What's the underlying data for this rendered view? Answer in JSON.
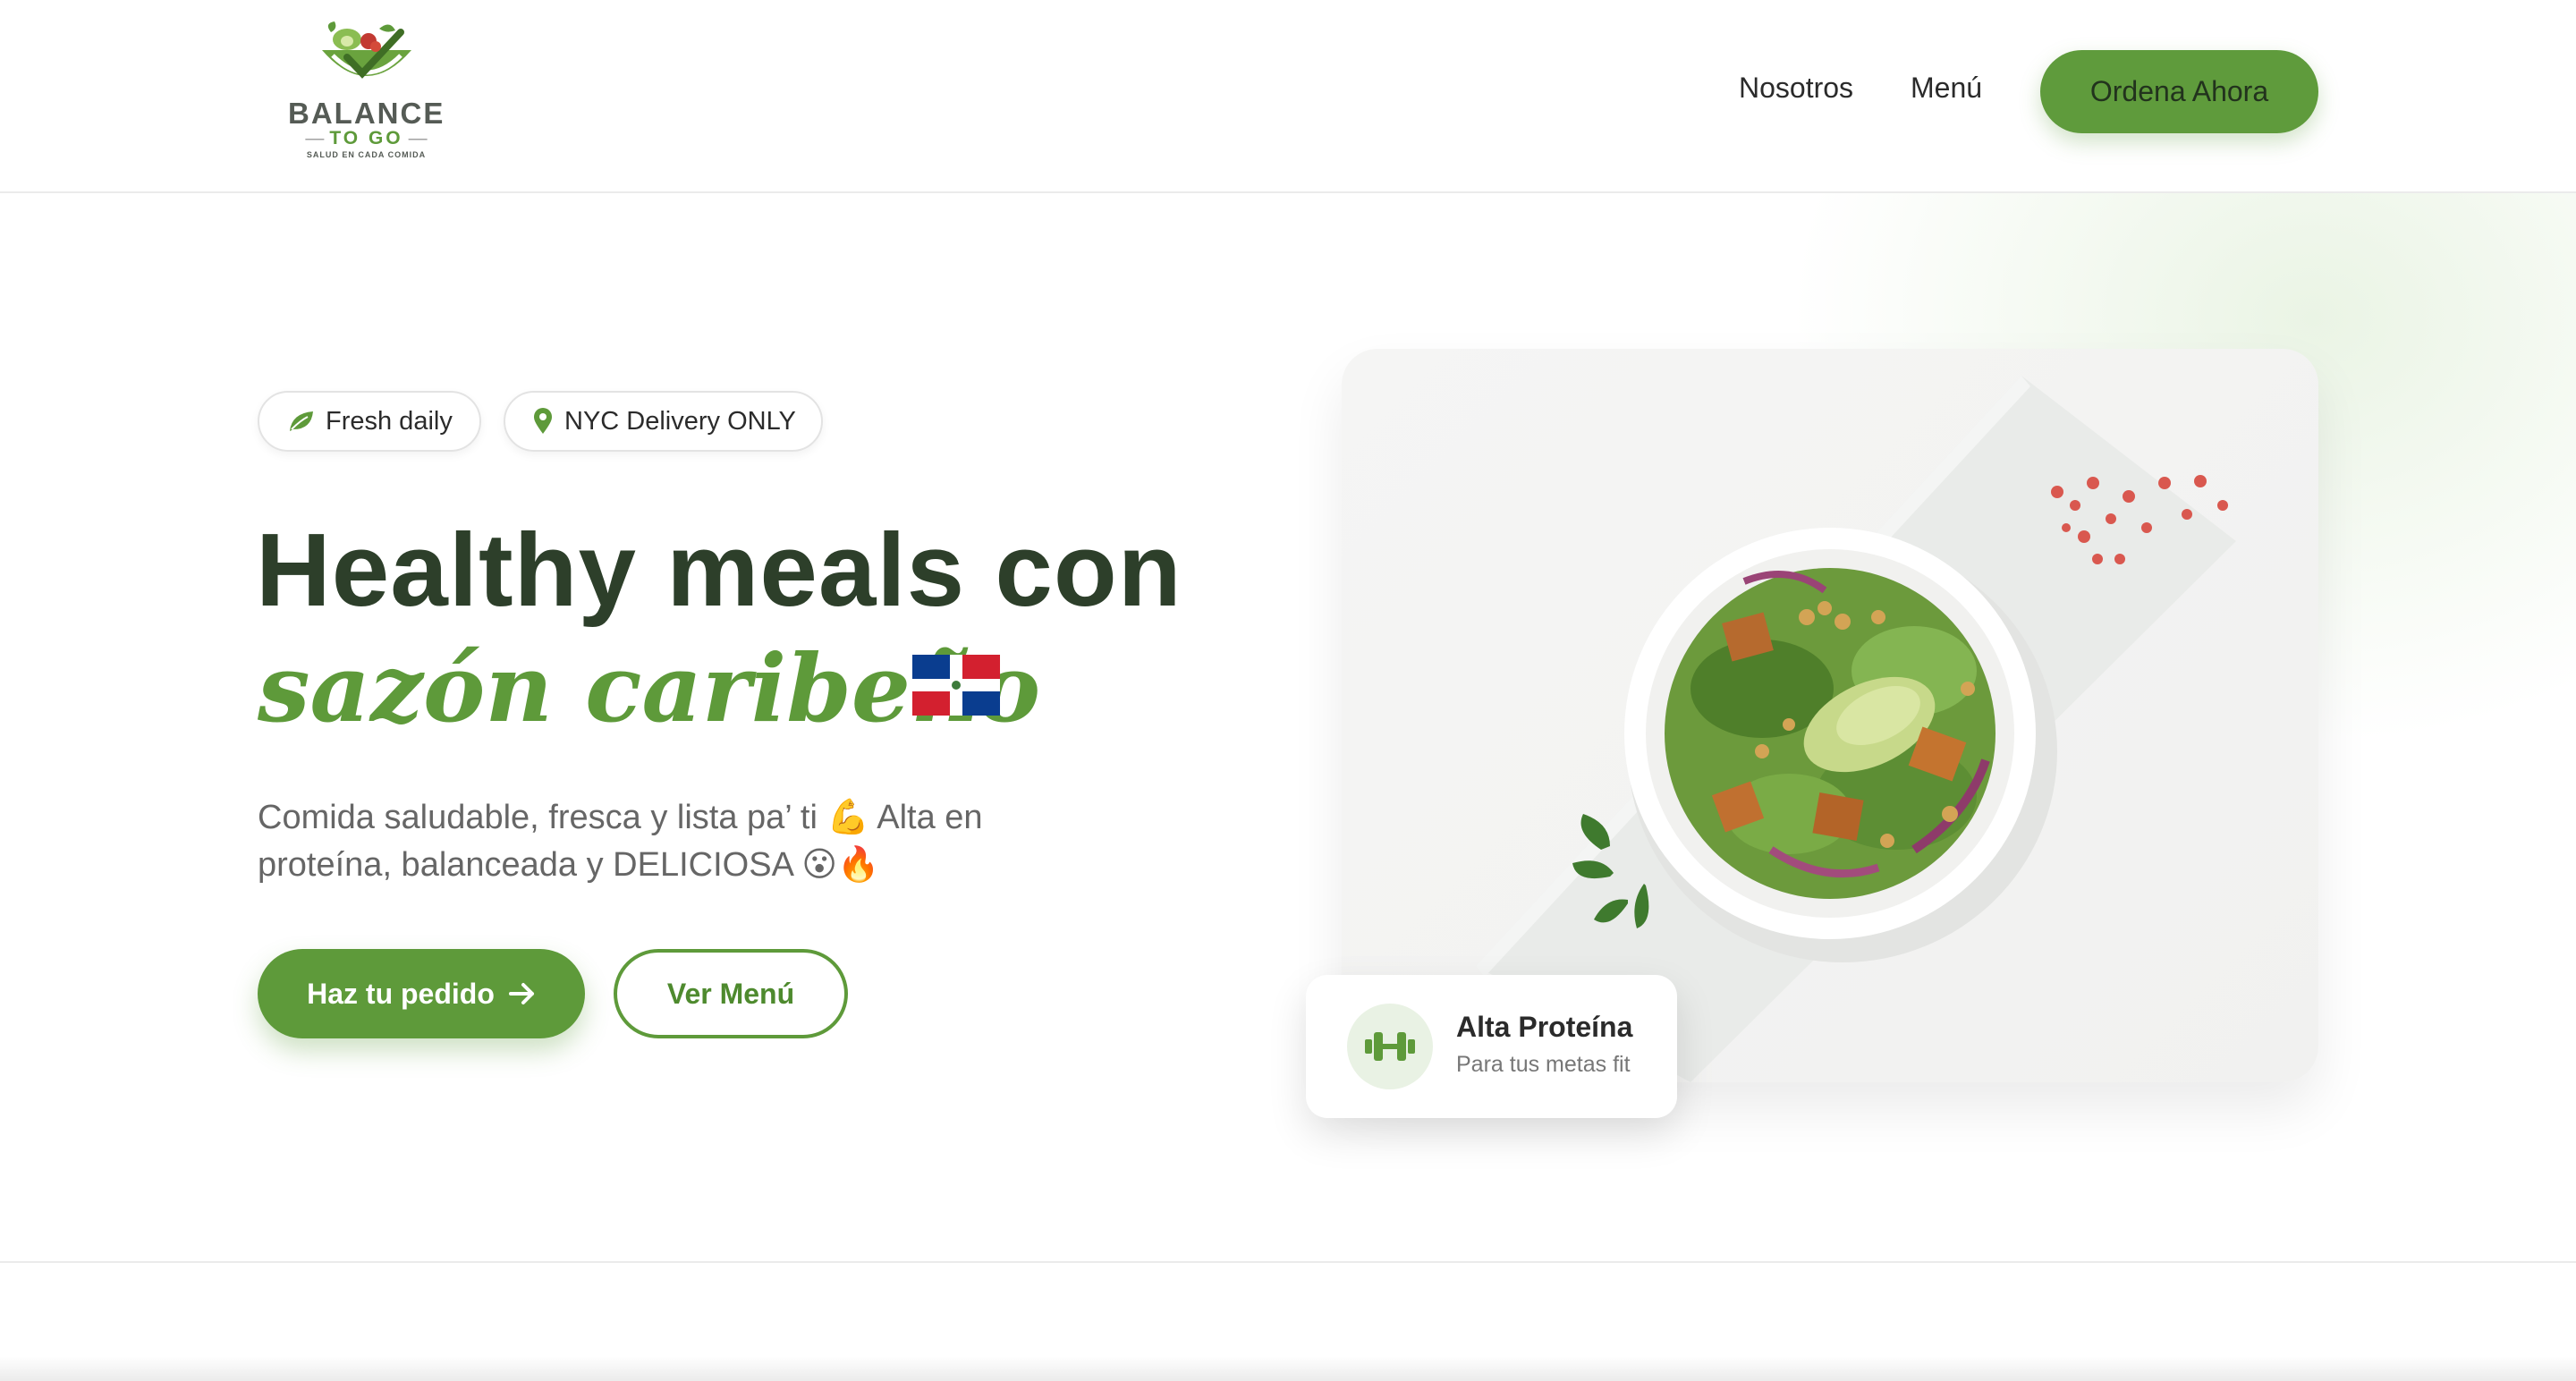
{
  "brand": {
    "name": "BALANCE",
    "sub": "TO GO",
    "tagline": "SALUD EN CADA COMIDA"
  },
  "nav": {
    "links": [
      "Nosotros",
      "Menú"
    ],
    "cta": "Ordena Ahora"
  },
  "hero": {
    "pills": [
      {
        "icon": "leaf-icon",
        "label": "Fresh daily"
      },
      {
        "icon": "map-pin-icon",
        "label": "NYC Delivery ONLY"
      }
    ],
    "headline_1": "Healthy meals con",
    "headline_2": "sazón caribeño",
    "flag": "dominican-republic-flag",
    "description": "Comida saludable, fresca y lista pa’ ti 💪 Alta en proteína, balanceada y DELICIOSA 😮🔥",
    "primary_button": "Haz tu pedido",
    "secondary_button": "Ver Menú"
  },
  "badge": {
    "icon": "dumbbell-icon",
    "title": "Alta Proteína",
    "subtitle": "Para tus metas fit"
  },
  "colors": {
    "accent": "#5e9a3a",
    "heading": "#2d3f2a",
    "text_muted": "#666666"
  }
}
